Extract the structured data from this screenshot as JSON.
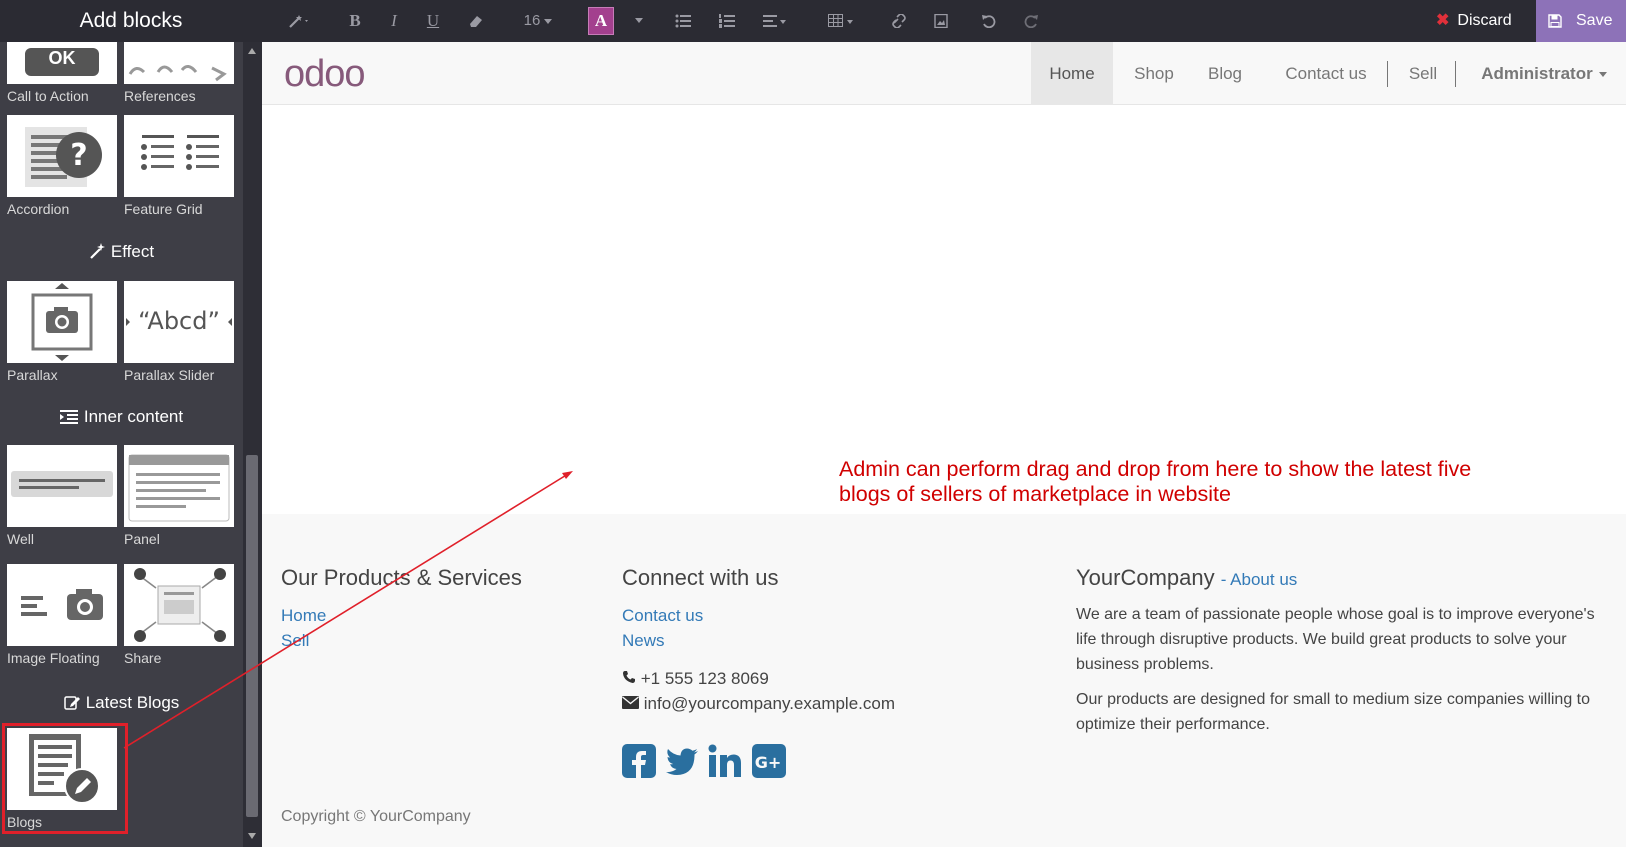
{
  "sidebar": {
    "title": "Add blocks",
    "blocks_top": [
      {
        "label": "Call to Action"
      },
      {
        "label": "References"
      },
      {
        "label": "Accordion"
      },
      {
        "label": "Feature Grid"
      }
    ],
    "section_effect": "Effect",
    "blocks_effect": [
      {
        "label": "Parallax"
      },
      {
        "label": "Parallax Slider"
      }
    ],
    "section_inner": "Inner content",
    "blocks_inner": [
      {
        "label": "Well"
      },
      {
        "label": "Panel"
      },
      {
        "label": "Image Floating"
      },
      {
        "label": "Share"
      }
    ],
    "section_latest_blogs": "Latest Blogs",
    "blocks_blogs": [
      {
        "label": "Blogs"
      }
    ],
    "partial_thumb_text": "OK",
    "parallax_slider_text": "“Abcd”"
  },
  "toolbar": {
    "font_size": "16",
    "color_letter": "A",
    "discard_label": "Discard",
    "save_label": "Save"
  },
  "navbar": {
    "logo": "odoo",
    "items": [
      "Home",
      "Shop",
      "Blog",
      "Contact us",
      "Sell"
    ],
    "active": "Home",
    "user": "Administrator"
  },
  "annotation": "Admin can perform drag and drop from here to show the latest five blogs of sellers of marketplace in website",
  "footer": {
    "col1_title": "Our Products & Services",
    "col1_links": [
      "Home",
      "Sell"
    ],
    "col2_title": "Connect with us",
    "col2_links": [
      "Contact us",
      "News"
    ],
    "phone": "+1 555 123 8069",
    "email": "info@yourcompany.example.com",
    "col3_title": "YourCompany",
    "col3_about": "- About us",
    "about_p1": "We are a team of passionate people whose goal is to improve everyone's life through disruptive products. We build great products to solve your business problems.",
    "about_p2": "Our products are designed for small to medium size companies willing to optimize their performance.",
    "copyright": "Copyright © YourCompany"
  },
  "colors": {
    "accent": "#875a7b",
    "save": "#8d72b8",
    "annotation": "#d00000",
    "link": "#337ab7"
  }
}
